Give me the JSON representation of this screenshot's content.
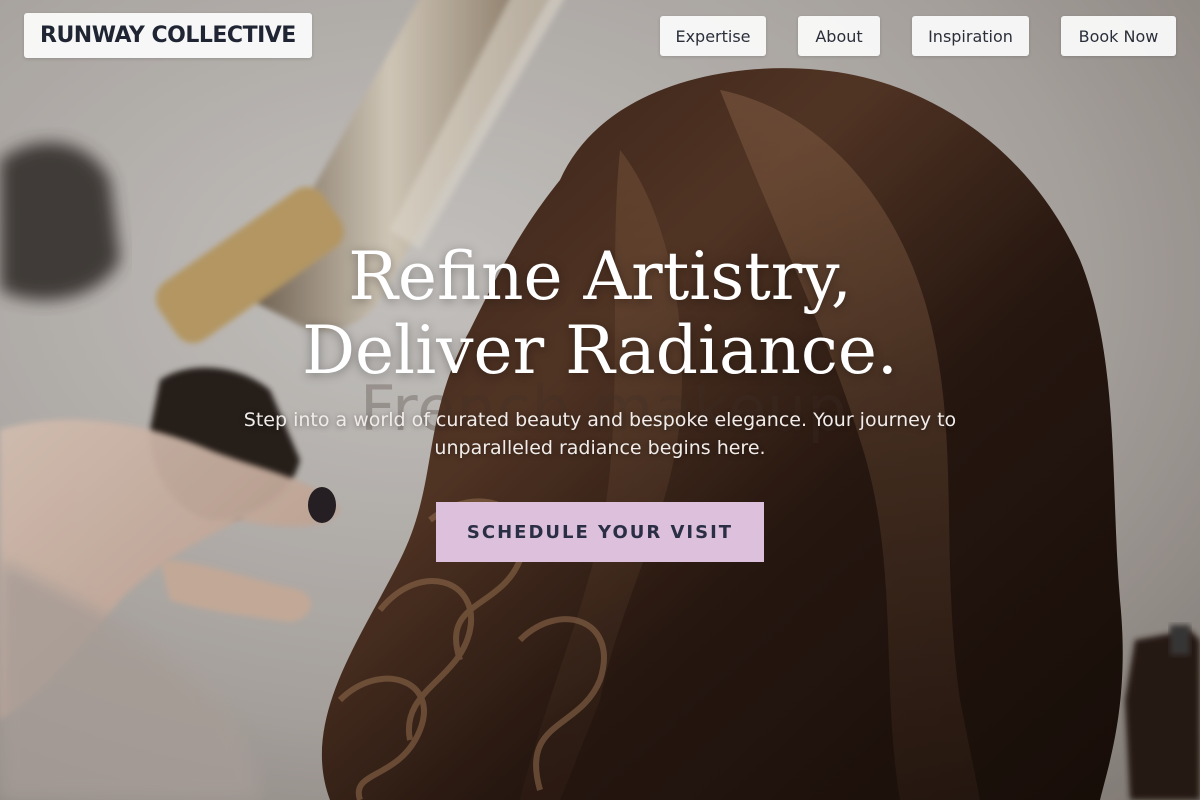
{
  "brand": {
    "name": "RUNWAY COLLECTIVE"
  },
  "nav": {
    "items": [
      {
        "label": "Expertise"
      },
      {
        "label": "About"
      },
      {
        "label": "Inspiration"
      },
      {
        "label": "Book Now"
      }
    ]
  },
  "hero": {
    "headline_line1": "Refine Artistry,",
    "headline_line2": "Deliver Radiance.",
    "subtext": "Step into a world of curated beauty and bespoke elegance. Your journey to unparalleled radiance begins here.",
    "cta_label": "SCHEDULE YOUR VISIT",
    "photo_lettering": "French makeup"
  },
  "colors": {
    "brand_text": "#1f2533",
    "nav_bg": "#fafafa",
    "cta_bg": "#dcc0dc",
    "cta_text": "#2a2f45",
    "headline": "#ffffff"
  }
}
